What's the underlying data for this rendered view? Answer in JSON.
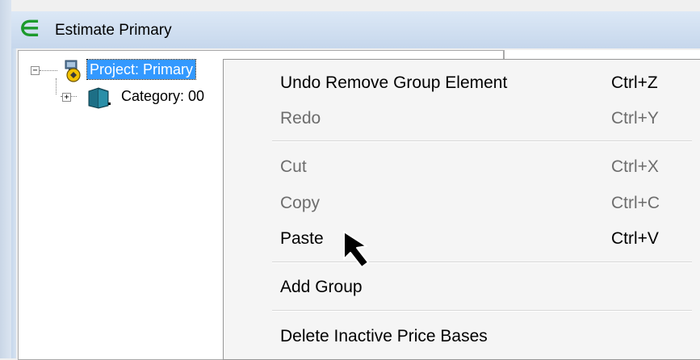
{
  "window": {
    "title": "Estimate Primary",
    "app_icon_glyph": "∈"
  },
  "tree": {
    "root": {
      "label": "Project: Primary",
      "expander": "−",
      "icon": "project-icon"
    },
    "child": {
      "label": "Category: 00",
      "expander": "+",
      "icon": "category-book-icon"
    }
  },
  "context_menu": {
    "items": [
      {
        "label": "Undo Remove Group Element",
        "shortcut": "Ctrl+Z",
        "enabled": true
      },
      {
        "label": "Redo",
        "shortcut": "Ctrl+Y",
        "enabled": false
      },
      {
        "label": "Cut",
        "shortcut": "Ctrl+X",
        "enabled": false
      },
      {
        "label": "Copy",
        "shortcut": "Ctrl+C",
        "enabled": false
      },
      {
        "label": "Paste",
        "shortcut": "Ctrl+V",
        "enabled": true
      },
      {
        "label": "Add Group",
        "shortcut": "",
        "enabled": true
      },
      {
        "label": "Delete Inactive Price Bases",
        "shortcut": "",
        "enabled": true
      }
    ]
  },
  "colors": {
    "selection": "#3399ff",
    "app_icon": "#1c9a2c",
    "disabled_text": "#6d6d6d"
  }
}
